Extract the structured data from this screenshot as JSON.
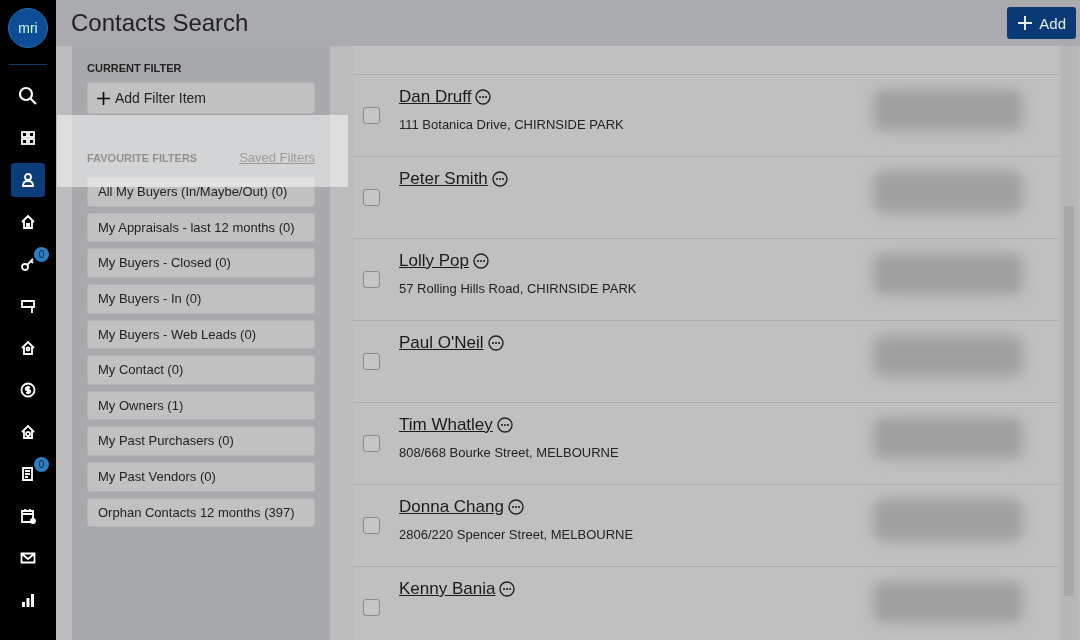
{
  "logo": "mri",
  "nav": [
    {
      "selected": false
    },
    {
      "selected": false
    },
    {
      "selected": true
    },
    {
      "selected": false
    },
    {
      "selected": false,
      "badge": "0"
    },
    {
      "selected": false
    },
    {
      "selected": false
    },
    {
      "selected": false
    },
    {
      "selected": false
    },
    {
      "selected": false,
      "badge": "0"
    },
    {
      "selected": false
    },
    {
      "selected": false
    },
    {
      "selected": false
    }
  ],
  "header": {
    "title": "Contacts Search",
    "add_button": "Add"
  },
  "filter_panel": {
    "current_filter_heading": "CURRENT FILTER",
    "add_filter_button": "Add Filter Item",
    "favourites_heading": "FAVOURITE FILTERS",
    "saved_filters_link": "Saved Filters",
    "favourites": [
      "All My Buyers (In/Maybe/Out) (0)",
      "My Appraisals - last 12 months (0)",
      "My Buyers - Closed (0)",
      "My Buyers - In (0)",
      "My Buyers - Web Leads (0)",
      "My Contact (0)",
      "My Owners (1)",
      "My Past Purchasers (0)",
      "My Past Vendors (0)",
      "Orphan Contacts 12 months (397)"
    ]
  },
  "contacts": [
    {
      "name": "Dan Druff",
      "address": "111 Botanica Drive, CHIRNSIDE PARK",
      "checked": false
    },
    {
      "name": "Peter Smith",
      "checked": false
    },
    {
      "name": "Lolly Pop",
      "address": "57 Rolling Hills Road, CHIRNSIDE PARK",
      "checked": false
    },
    {
      "name": "Paul O'Neil",
      "checked": false
    },
    {
      "name": "Tim Whatley",
      "address": "808/668 Bourke Street, MELBOURNE",
      "checked": false
    },
    {
      "name": "Donna Chang",
      "address": "2806/220 Spencer Street, MELBOURNE",
      "checked": false
    },
    {
      "name": "Kenny Bania",
      "checked": false
    }
  ]
}
